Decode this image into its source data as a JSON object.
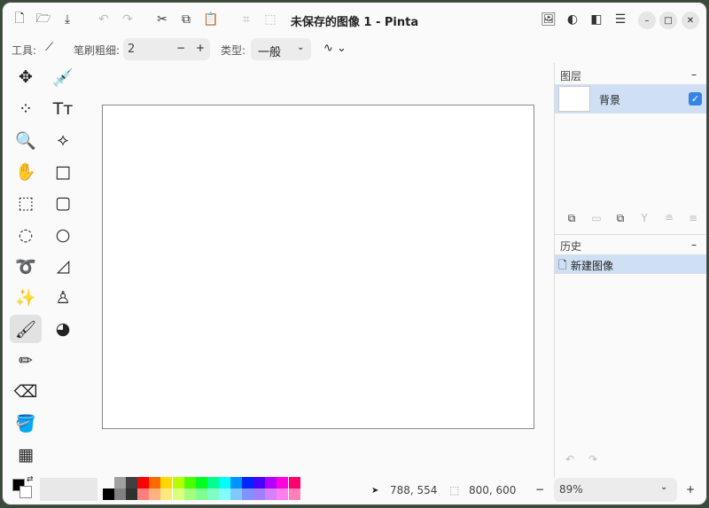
{
  "window": {
    "title": "未保存的图像 1 - Pinta"
  },
  "header": {
    "icons": [
      "new-image-icon",
      "open-icon",
      "save-icon",
      "undo-icon",
      "redo-icon",
      "cut-icon",
      "copy-icon",
      "paste-icon",
      "crop-icon",
      "deselect-icon"
    ],
    "right_icons": [
      "image-menu-icon",
      "adjustments-icon",
      "effects-icon",
      "main-menu-icon"
    ]
  },
  "toolbar": {
    "tool_label": "工具:",
    "brush_width_label": "笔刷粗细:",
    "brush_width": "2",
    "minus": "−",
    "plus": "+",
    "type_label": "类型:",
    "type_value": "一般"
  },
  "tools": {
    "left": [
      "move-selected",
      "move-selection",
      "zoom",
      "pan",
      "rectangle-select",
      "ellipse-select",
      "lasso-select",
      "magic-wand",
      "paintbrush",
      "pencil",
      "eraser",
      "paint-bucket",
      "gradient"
    ],
    "right": [
      "color-picker",
      "text",
      "line-curve",
      "rectangle",
      "rounded-rectangle",
      "ellipse",
      "freeform-shape",
      "clone-stamp",
      "recolor"
    ],
    "active": "paintbrush"
  },
  "layers": {
    "title": "图层",
    "collapse": "–",
    "items": [
      {
        "name": "背景",
        "visible": true
      }
    ]
  },
  "history": {
    "title": "历史",
    "collapse": "–",
    "items": [
      {
        "label": "新建图像"
      }
    ]
  },
  "palette": {
    "primary": "#000000",
    "secondary": "#ffffff",
    "top": [
      "#a0a0a0",
      "#404040",
      "#ff0000",
      "#ff6a00",
      "#ffd800",
      "#b6ff00",
      "#4cff00",
      "#00ff21",
      "#00ff90",
      "#00ffff",
      "#0094ff",
      "#0026ff",
      "#4800ff",
      "#b200ff",
      "#ff00dc",
      "#ff006e"
    ],
    "bottom": [
      "#808080",
      "#303030",
      "#ff7f7f",
      "#ffb27f",
      "#ffe97f",
      "#daff7f",
      "#a5ff7f",
      "#7fff90",
      "#7fffc5",
      "#7fffff",
      "#7fc9ff",
      "#7f92ff",
      "#a17fff",
      "#d67fff",
      "#ff7fed",
      "#ff7fb6"
    ]
  },
  "status": {
    "cursor": "788, 554",
    "selection": "800, 600",
    "zoom": "89%",
    "zoom_minus": "−",
    "zoom_plus": "+"
  },
  "accent": "#3584e4"
}
